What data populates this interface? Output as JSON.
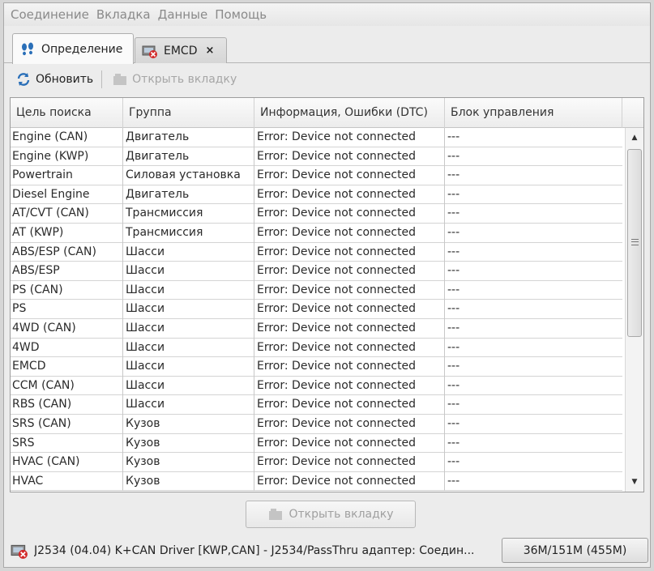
{
  "menu": [
    "Соединение",
    "Вкладка",
    "Данные",
    "Помощь"
  ],
  "tabs": [
    {
      "label": "Определение",
      "icon": "footprints-icon"
    },
    {
      "label": "EMCD",
      "icon": "disconnected-device-icon",
      "close": "×"
    }
  ],
  "toolbar": {
    "refresh_label": "Обновить",
    "open_tab_label": "Открыть вкладку"
  },
  "table": {
    "columns": [
      "Цель поиска",
      "Группа",
      "Информация, Ошибки (DTC)",
      "Блок управления"
    ],
    "rows": [
      [
        "Engine (CAN)",
        "Двигатель",
        "Error: Device not connected",
        "---"
      ],
      [
        "Engine (KWP)",
        "Двигатель",
        "Error: Device not connected",
        "---"
      ],
      [
        "Powertrain",
        "Силовая установка",
        "Error: Device not connected",
        "---"
      ],
      [
        "Diesel Engine",
        "Двигатель",
        "Error: Device not connected",
        "---"
      ],
      [
        "AT/CVT (CAN)",
        "Трансмиссия",
        "Error: Device not connected",
        "---"
      ],
      [
        "AT (KWP)",
        "Трансмиссия",
        "Error: Device not connected",
        "---"
      ],
      [
        "ABS/ESP (CAN)",
        "Шасси",
        "Error: Device not connected",
        "---"
      ],
      [
        "ABS/ESP",
        "Шасси",
        "Error: Device not connected",
        "---"
      ],
      [
        "PS (CAN)",
        "Шасси",
        "Error: Device not connected",
        "---"
      ],
      [
        "PS",
        "Шасси",
        "Error: Device not connected",
        "---"
      ],
      [
        "4WD (CAN)",
        "Шасси",
        "Error: Device not connected",
        "---"
      ],
      [
        "4WD",
        "Шасси",
        "Error: Device not connected",
        "---"
      ],
      [
        "EMCD",
        "Шасси",
        "Error: Device not connected",
        "---"
      ],
      [
        "CCM (CAN)",
        "Шасси",
        "Error: Device not connected",
        "---"
      ],
      [
        "RBS (CAN)",
        "Шасси",
        "Error: Device not connected",
        "---"
      ],
      [
        "SRS (CAN)",
        "Кузов",
        "Error: Device not connected",
        "---"
      ],
      [
        "SRS",
        "Кузов",
        "Error: Device not connected",
        "---"
      ],
      [
        "HVAC (CAN)",
        "Кузов",
        "Error: Device not connected",
        "---"
      ],
      [
        "HVAC",
        "Кузов",
        "Error: Device not connected",
        "---"
      ]
    ]
  },
  "bottom_button": {
    "label": "Открыть вкладку"
  },
  "status": {
    "text": "J2534 (04.04) K+CAN Driver [KWP,CAN] - J2534/PassThru адаптер: Соедин...",
    "memory": "36M/151M (455M)"
  },
  "colors": {
    "accent_blue": "#2a6fb8",
    "error_red": "#d22a2a",
    "disabled": "#a6a6a6"
  }
}
